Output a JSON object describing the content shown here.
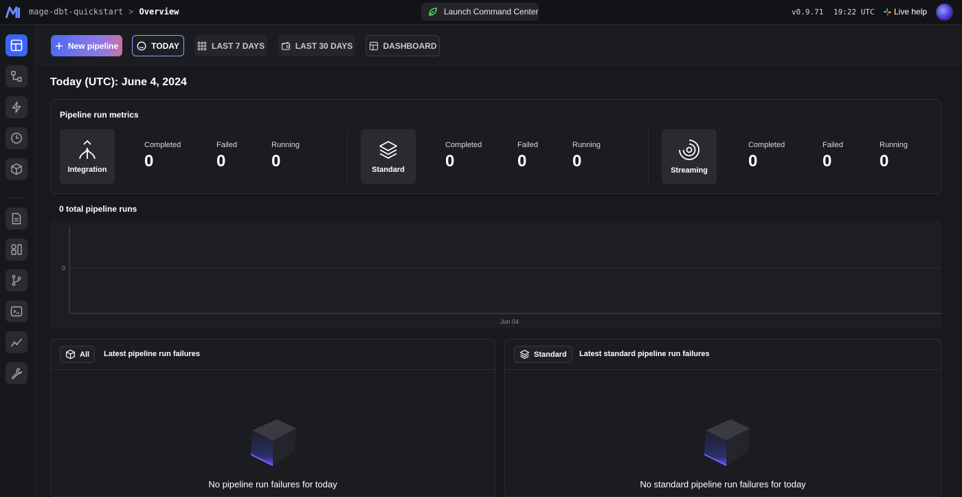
{
  "topbar": {
    "project": "mage-dbt-quickstart",
    "separator": ">",
    "page": "Overview",
    "launch_label": "Launch Command Center",
    "version": "v0.9.71",
    "clock": "19:22 UTC",
    "live_help": "Live help"
  },
  "toolbar": {
    "new_pipeline": "New pipeline",
    "today": "TODAY",
    "last7": "LAST 7 DAYS",
    "last30": "LAST 30 DAYS",
    "dashboard": "DASHBOARD"
  },
  "page_title": "Today (UTC): June 4, 2024",
  "metrics": {
    "title": "Pipeline run metrics",
    "groups": [
      {
        "label": "Integration",
        "icon": "integration-icon",
        "completed_label": "Completed",
        "completed": "0",
        "failed_label": "Failed",
        "failed": "0",
        "running_label": "Running",
        "running": "0"
      },
      {
        "label": "Standard",
        "icon": "layers-icon",
        "completed_label": "Completed",
        "completed": "0",
        "failed_label": "Failed",
        "failed": "0",
        "running_label": "Running",
        "running": "0"
      },
      {
        "label": "Streaming",
        "icon": "streaming-icon",
        "completed_label": "Completed",
        "completed": "0",
        "failed_label": "Failed",
        "failed": "0",
        "running_label": "Running",
        "running": "0"
      }
    ]
  },
  "runs": {
    "title": "0 total pipeline runs"
  },
  "chart_data": {
    "type": "line",
    "categories": [
      "Jun 04"
    ],
    "series": [
      {
        "values": [
          0
        ]
      }
    ],
    "yticks": [
      "0"
    ]
  },
  "panels": {
    "all": {
      "chip": "All",
      "title": "Latest pipeline run failures",
      "empty": "No pipeline run failures for today"
    },
    "standard": {
      "chip": "Standard",
      "title": "Latest standard pipeline run failures",
      "empty": "No standard pipeline run failures for today"
    }
  },
  "colors": {
    "accent": "#3c63f5",
    "background": "#18191d",
    "card": "#2a2b31"
  }
}
